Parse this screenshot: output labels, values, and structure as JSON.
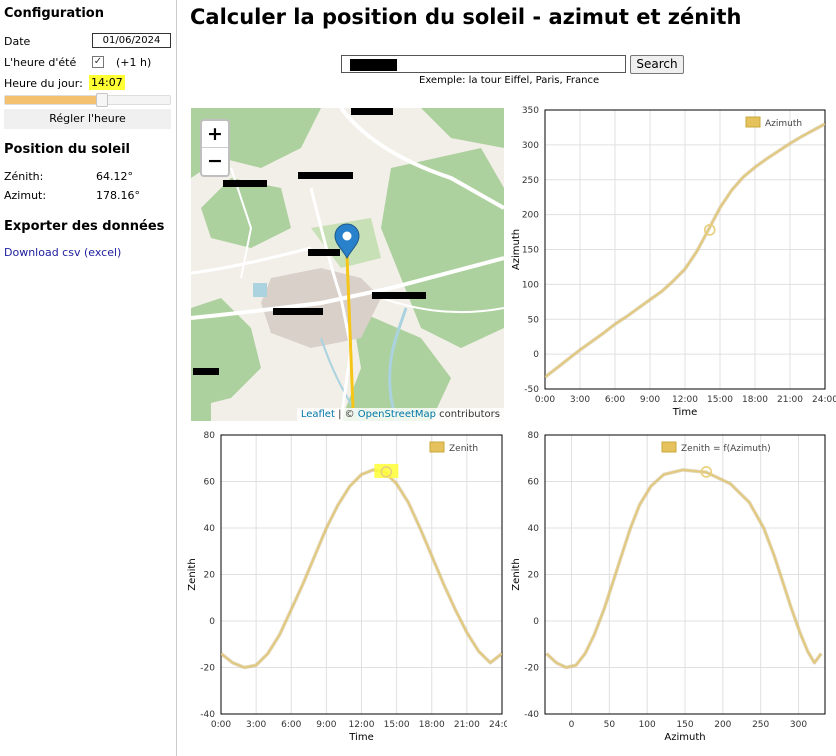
{
  "sidebar": {
    "config_title": "Configuration",
    "date_label": "Date",
    "date_value": "01/06/2024",
    "dst_label": "L'heure d'été",
    "dst_checked": true,
    "dst_offset": "(+1 h)",
    "hour_label": "Heure du jour:",
    "hour_value": "14:07",
    "hour_fraction": 0.588,
    "set_hour_button": "Régler l'heure",
    "sun_position_title": "Position du soleil",
    "zenith_label": "Zénith:",
    "zenith_value": "64.12°",
    "azimuth_label": "Azimut:",
    "azimuth_value": "178.16°",
    "export_title": "Exporter des données",
    "download_link": "Download csv (excel)"
  },
  "main": {
    "title": "Calculer la position du soleil - azimut et zénith",
    "search_button": "Search",
    "search_example": "Exemple: la tour Eiffel, Paris, France"
  },
  "map": {
    "zoom_in": "+",
    "zoom_out": "−",
    "attribution_leaflet": "Leaflet",
    "attribution_sep": " | © ",
    "attribution_osm": "OpenStreetMap",
    "attribution_tail": " contributors",
    "colors": {
      "forest": "#add19e",
      "land": "#f2efe9",
      "urban": "#d9d0c9",
      "road": "#ffffff",
      "water": "#aad3df",
      "sun_line": "#f5c518",
      "marker": "#2a81cb"
    }
  },
  "chart_data": [
    {
      "type": "line",
      "id": "azimuth-time",
      "legend": "Azimuth",
      "xlabel": "Time",
      "ylabel": "Azimuth",
      "xticks": [
        "0:00",
        "3:00",
        "6:00",
        "9:00",
        "12:00",
        "15:00",
        "18:00",
        "21:00",
        "24:00"
      ],
      "xlim": [
        0,
        24
      ],
      "ylim": [
        -50,
        350
      ],
      "yticks": [
        -50,
        0,
        50,
        100,
        150,
        200,
        250,
        300,
        350
      ],
      "x": [
        0,
        1,
        2,
        3,
        4,
        5,
        6,
        7,
        8,
        9,
        10,
        11,
        12,
        13,
        14,
        15,
        16,
        17,
        18,
        19,
        20,
        21,
        22,
        23,
        24
      ],
      "y": [
        -33,
        -20,
        -7,
        6,
        18,
        30,
        43,
        54,
        66,
        78,
        90,
        105,
        122,
        147,
        178,
        210,
        235,
        254,
        268,
        280,
        291,
        302,
        312,
        321,
        330
      ],
      "current": {
        "x": 14.12,
        "y": 178.16
      }
    },
    {
      "type": "line",
      "id": "zenith-time",
      "legend": "Zenith",
      "xlabel": "Time",
      "ylabel": "Zenith",
      "xticks": [
        "0:00",
        "3:00",
        "6:00",
        "9:00",
        "12:00",
        "15:00",
        "18:00",
        "21:00",
        "24:00"
      ],
      "xlim": [
        0,
        24
      ],
      "ylim": [
        -40,
        80
      ],
      "yticks": [
        -40,
        -20,
        0,
        20,
        40,
        60,
        80
      ],
      "x": [
        0,
        1,
        2,
        3,
        4,
        5,
        6,
        7,
        8,
        9,
        10,
        11,
        12,
        13,
        14,
        15,
        16,
        17,
        18,
        19,
        20,
        21,
        22,
        23,
        24
      ],
      "y": [
        -14,
        -18,
        -20,
        -19,
        -14,
        -6,
        5,
        16,
        28,
        40,
        50,
        58,
        63,
        65,
        64,
        59,
        51,
        40,
        28,
        16,
        5,
        -5,
        -13,
        -18,
        -14
      ],
      "current": {
        "x": 14.12,
        "y": 64.12
      }
    },
    {
      "type": "line",
      "id": "zenith-azimuth",
      "legend": "Zenith = f(Azimuth)",
      "xlabel": "Azimuth",
      "ylabel": "Zenith",
      "xlim": [
        -35,
        335
      ],
      "xticks": [
        0,
        50,
        100,
        150,
        200,
        250,
        300
      ],
      "ylim": [
        -40,
        80
      ],
      "yticks": [
        -40,
        -20,
        0,
        20,
        40,
        60,
        80
      ],
      "x": [
        -33,
        -20,
        -7,
        6,
        18,
        30,
        43,
        54,
        66,
        78,
        90,
        105,
        122,
        147,
        178,
        210,
        235,
        254,
        268,
        280,
        291,
        302,
        312,
        321,
        330
      ],
      "y": [
        -14,
        -18,
        -20,
        -19,
        -14,
        -6,
        5,
        16,
        28,
        40,
        50,
        58,
        63,
        65,
        64,
        59,
        51,
        40,
        28,
        16,
        5,
        -5,
        -13,
        -18,
        -14
      ],
      "current": {
        "x": 178.16,
        "y": 64.12
      }
    }
  ]
}
